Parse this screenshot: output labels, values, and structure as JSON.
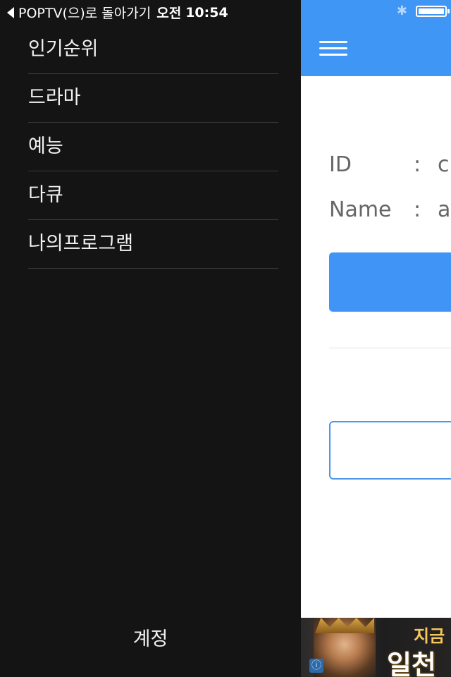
{
  "status_bar": {
    "back_label": "POPTV(으)로 돌아가기",
    "time_period": "오전",
    "time": "10:54",
    "icons": [
      "back-caret-icon",
      "bluetooth-icon",
      "battery-icon"
    ],
    "battery_level_percent": 100
  },
  "side_menu": {
    "items": [
      {
        "label": "인기순위"
      },
      {
        "label": "드라마"
      },
      {
        "label": "예능"
      },
      {
        "label": "다큐"
      },
      {
        "label": "나의프로그램"
      }
    ],
    "account_label": "계정"
  },
  "main": {
    "header": {
      "menu_icon": "hamburger-menu-icon",
      "color": "#3f96f4"
    },
    "id_label": "ID",
    "id_colon": ":",
    "id_value": "c",
    "name_label": "Name",
    "name_colon": ":",
    "name_value": "a",
    "button_color": "#4094f5",
    "input_border_color": "#4b97ea"
  },
  "ad": {
    "text_top": "지금",
    "text_main": "일천",
    "info_icon": "ad-info-icon"
  },
  "colors": {
    "menu_background": "#141414",
    "menu_text": "#f2f2f2",
    "accent": "#3f96f4"
  }
}
